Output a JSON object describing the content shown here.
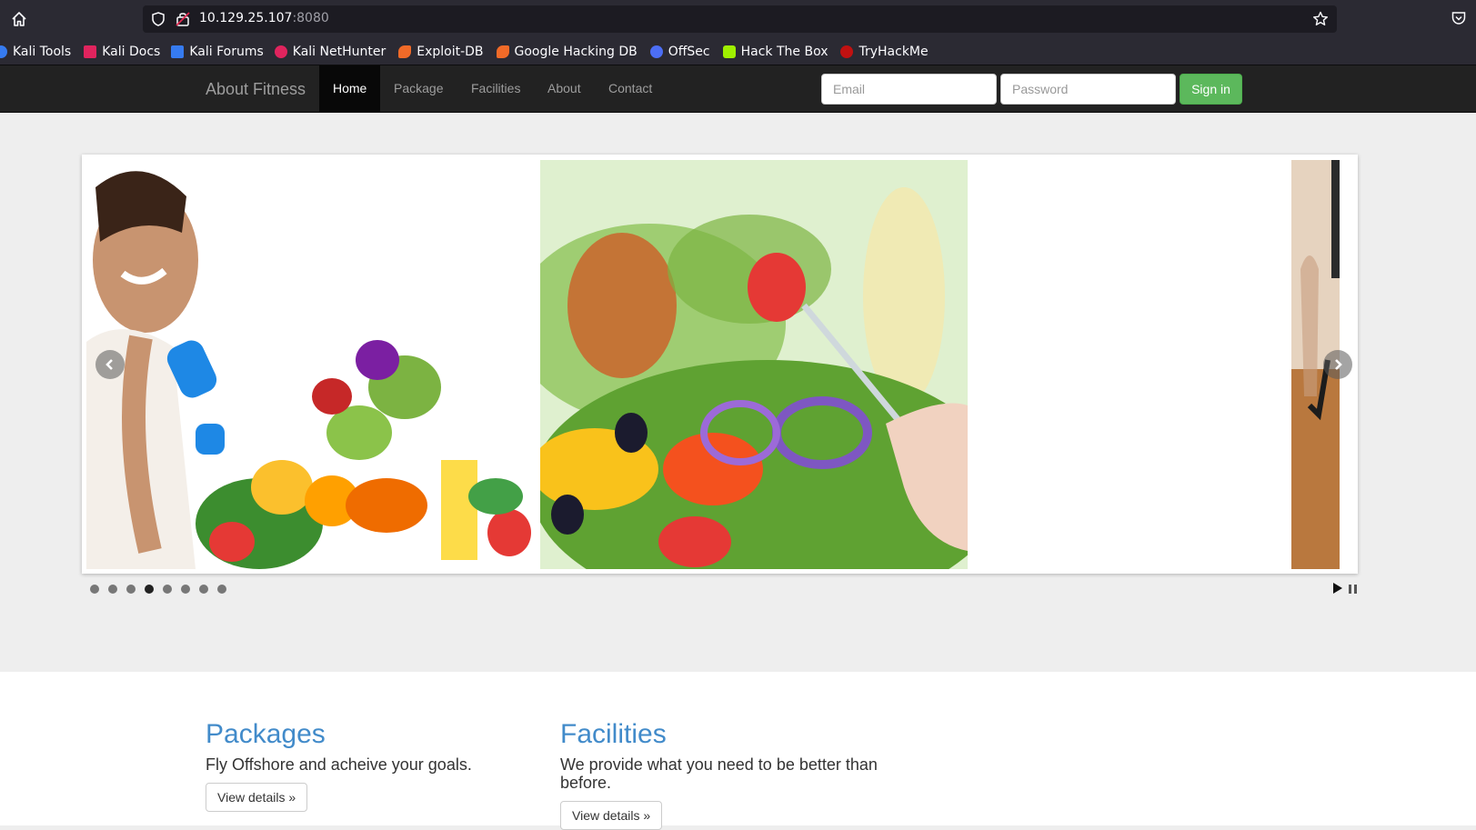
{
  "browser": {
    "url_host": "10.129.25.107",
    "url_port": ":8080",
    "bookmarks": [
      {
        "label": "Kali Tools",
        "icon": "kali-tools-icon",
        "color": "#367bf0"
      },
      {
        "label": "Kali Docs",
        "icon": "kali-docs-icon",
        "color": "#e0245e"
      },
      {
        "label": "Kali Forums",
        "icon": "kali-forums-icon",
        "color": "#367bf0"
      },
      {
        "label": "Kali NetHunter",
        "icon": "kali-nethunter-icon",
        "color": "#e0245e"
      },
      {
        "label": "Exploit-DB",
        "icon": "exploit-db-icon",
        "color": "#f06a28"
      },
      {
        "label": "Google Hacking DB",
        "icon": "ghdb-icon",
        "color": "#f06a28"
      },
      {
        "label": "OffSec",
        "icon": "offsec-icon",
        "color": "#4c6ef5"
      },
      {
        "label": "Hack The Box",
        "icon": "hackthebox-icon",
        "color": "#9fef00"
      },
      {
        "label": "TryHackMe",
        "icon": "tryhackme-icon",
        "color": "#c11111"
      }
    ]
  },
  "nav": {
    "brand": "About Fitness",
    "links": [
      "Home",
      "Package",
      "Facilities",
      "About",
      "Contact"
    ],
    "active_link": "Home",
    "email_placeholder": "Email",
    "password_placeholder": "Password",
    "signin_label": "Sign in",
    "signin_color": "#5cb85c"
  },
  "carousel": {
    "dots_total": 8,
    "active_dot_index": 3
  },
  "sections": [
    {
      "title": "Packages",
      "text": "Fly Offshore and acheive your goals.",
      "button": "View details »"
    },
    {
      "title": "Facilities",
      "text": "We provide what you need to be better than before.",
      "button": "View details »"
    }
  ]
}
